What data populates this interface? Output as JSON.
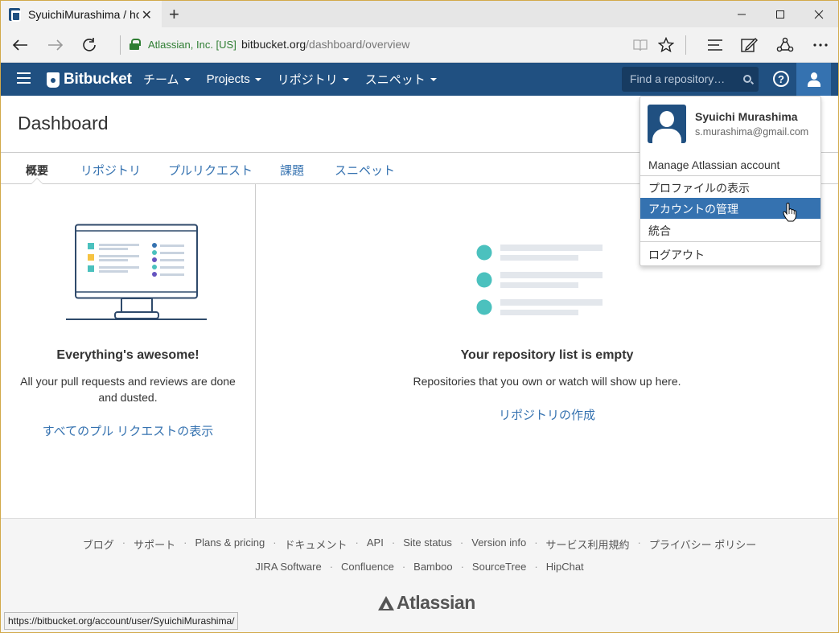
{
  "browser": {
    "tab_title": "SyuichiMurashima / hor",
    "tab_close": "✕",
    "new_tab": "+",
    "cert_name": "Atlassian, Inc. [US]",
    "url_host": "bitbucket.org",
    "url_path": "/dashboard/overview",
    "status_url": "https://bitbucket.org/account/user/SyuichiMurashima/"
  },
  "header": {
    "brand": "Bitbucket",
    "menu": [
      {
        "label": "チーム"
      },
      {
        "label": "Projects"
      },
      {
        "label": "リポジトリ"
      },
      {
        "label": "スニペット"
      }
    ],
    "search_placeholder": "Find a repository…",
    "help": "?"
  },
  "page": {
    "title": "Dashboard",
    "tabs": [
      {
        "label": "概要"
      },
      {
        "label": "リポジトリ"
      },
      {
        "label": "プルリクエスト"
      },
      {
        "label": "課題"
      },
      {
        "label": "スニペット"
      }
    ]
  },
  "left_panel": {
    "heading": "Everything's awesome!",
    "text_line1": "All your pull requests and reviews are done",
    "text_line2": "and dusted.",
    "link": "すべてのプル リクエストの表示"
  },
  "right_panel": {
    "heading": "Your repository list is empty",
    "text": "Repositories that you own or watch will show up here.",
    "link": "リポジトリの作成"
  },
  "footer": {
    "row1": [
      "ブログ",
      "サポート",
      "Plans & pricing",
      "ドキュメント",
      "API",
      "Site status",
      "Version info",
      "サービス利用規約",
      "プライバシー ポリシー"
    ],
    "row2": [
      "JIRA Software",
      "Confluence",
      "Bamboo",
      "SourceTree",
      "HipChat"
    ],
    "logo": "Atlassian",
    "separator": "·"
  },
  "dropdown": {
    "name": "Syuichi Murashima",
    "email": "s.murashima@gmail.com",
    "manage": "Manage Atlassian account",
    "items": [
      {
        "label": "プロファイルの表示"
      },
      {
        "label": "アカウントの管理"
      },
      {
        "label": "統合"
      },
      {
        "label": "ログアウト"
      }
    ]
  },
  "colors": {
    "brand": "#205081",
    "accent": "#3572b0",
    "teal": "#4bc1be"
  }
}
